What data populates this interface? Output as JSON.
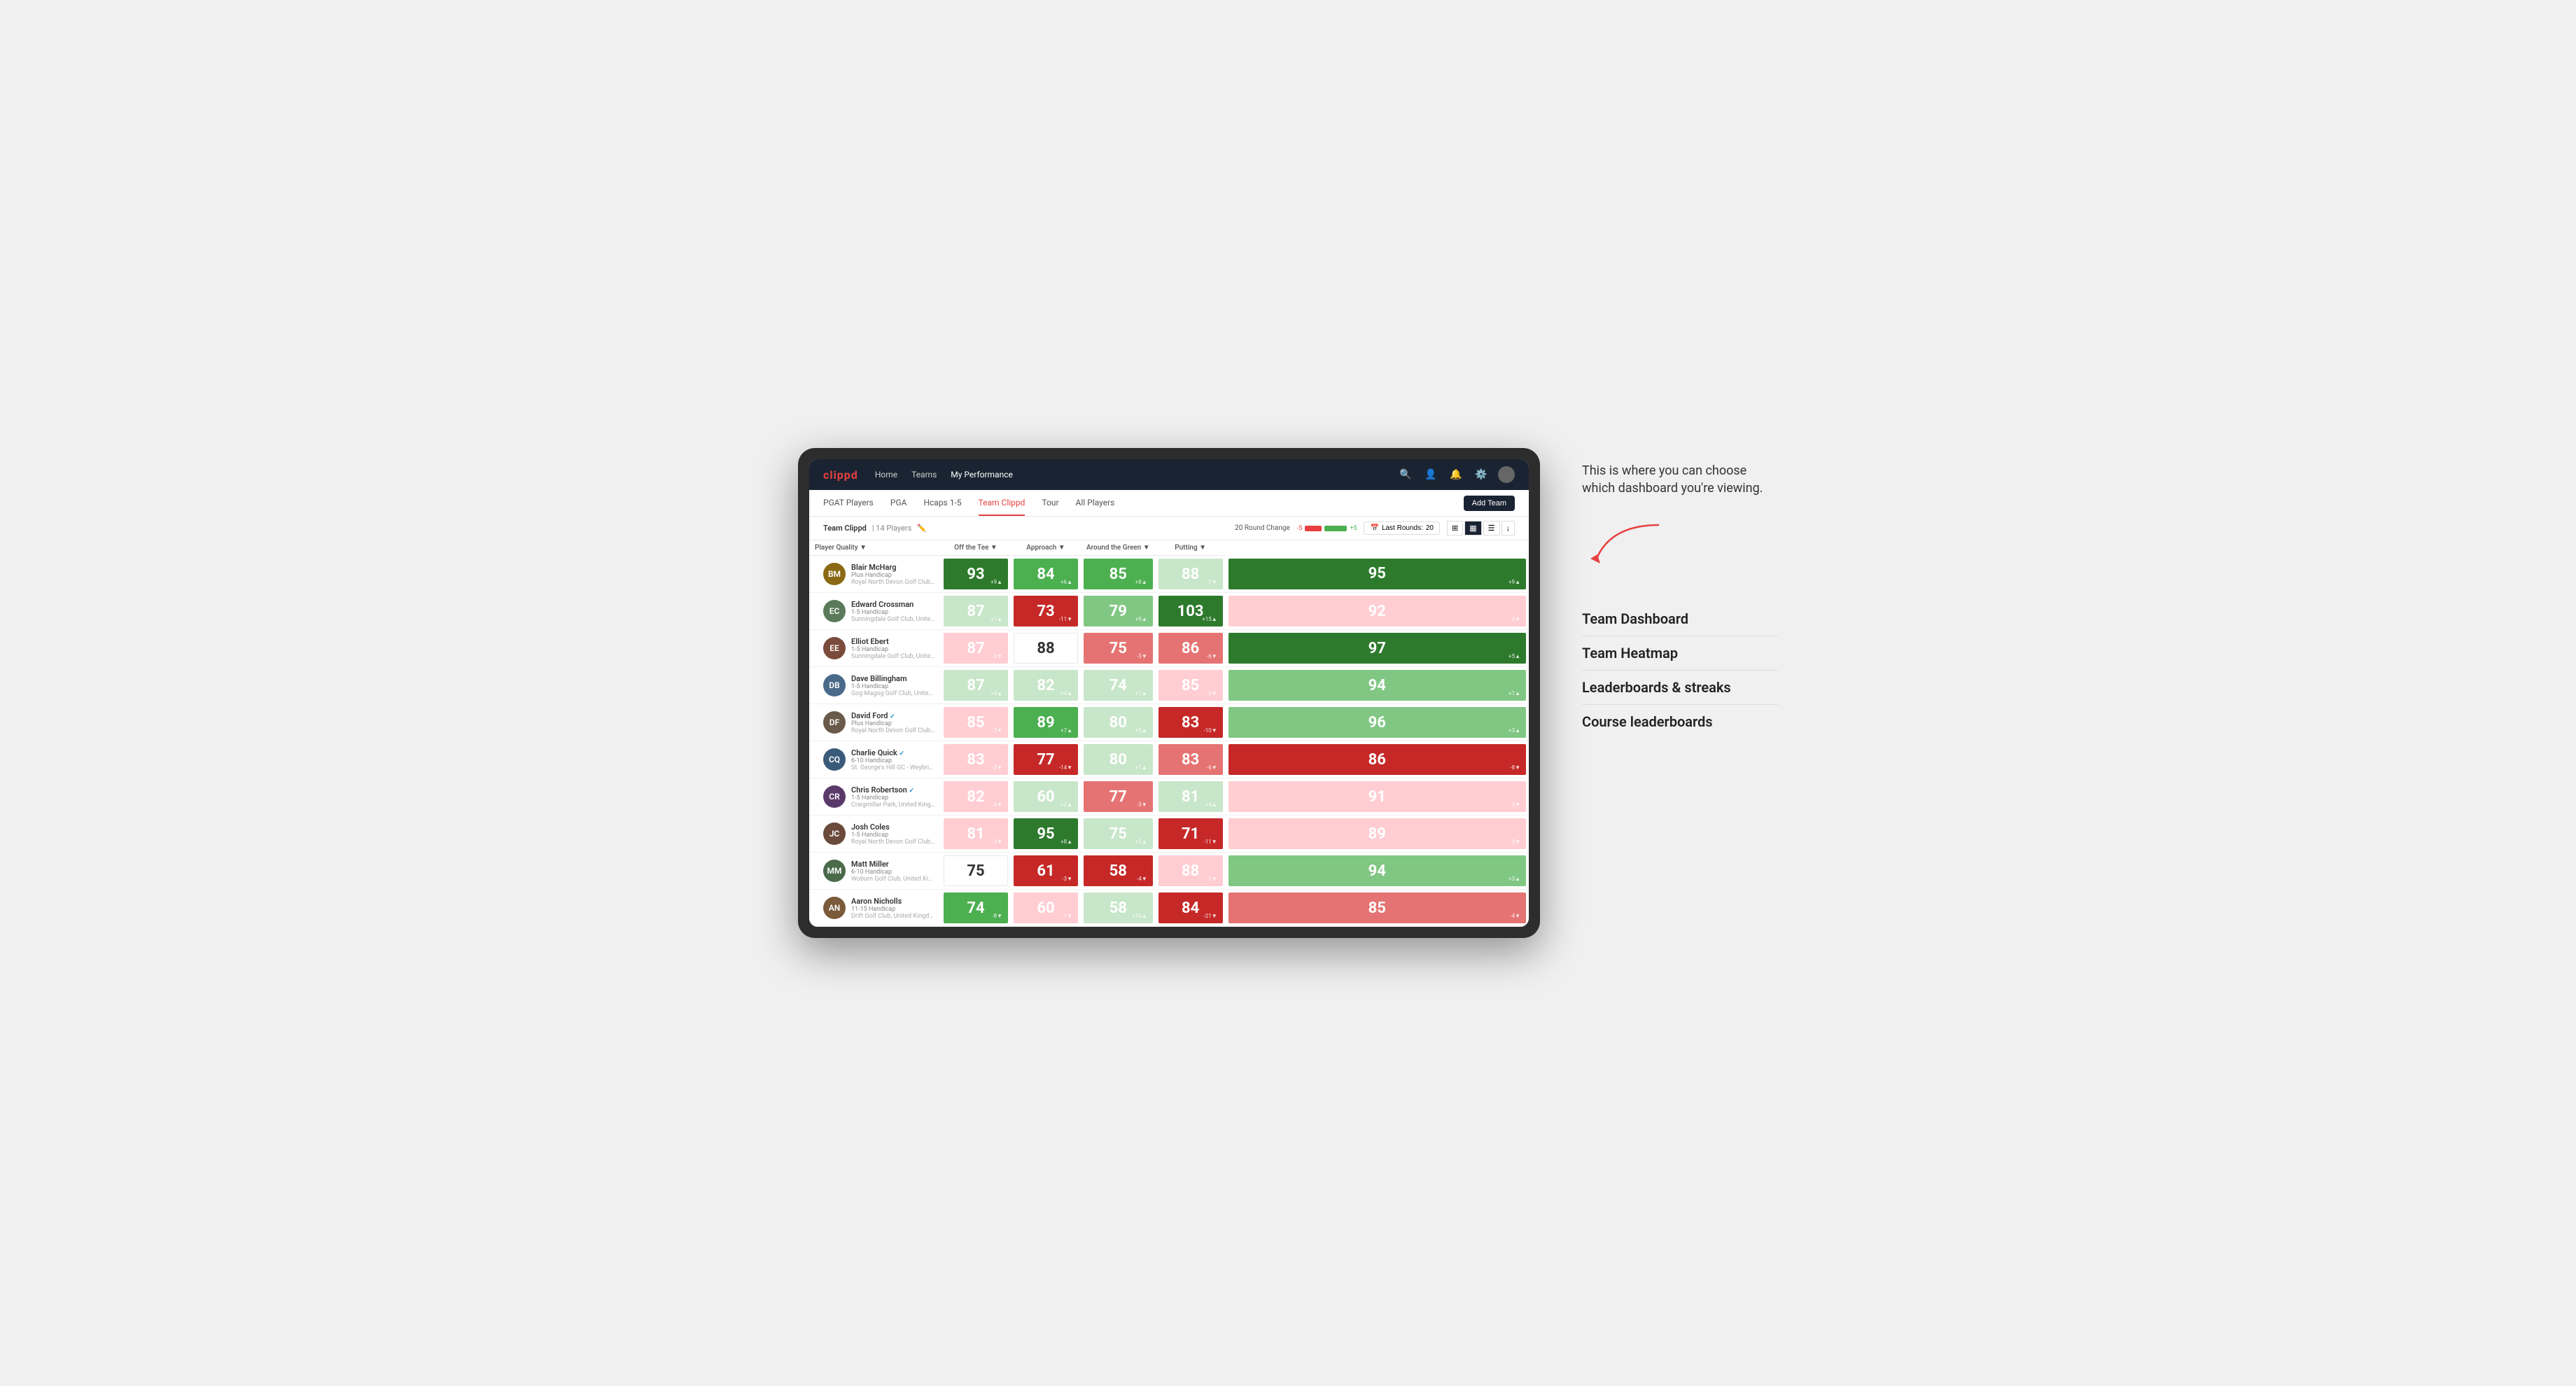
{
  "annotation": {
    "description": "This is where you can choose which dashboard you're viewing.",
    "menu_items": [
      "Team Dashboard",
      "Team Heatmap",
      "Leaderboards & streaks",
      "Course leaderboards"
    ]
  },
  "nav": {
    "logo": "clippd",
    "links": [
      "Home",
      "Teams",
      "My Performance"
    ],
    "active_link": "My Performance"
  },
  "sub_nav": {
    "links": [
      "PGAT Players",
      "PGA",
      "Hcaps 1-5",
      "Team Clippd",
      "Tour",
      "All Players"
    ],
    "active_link": "Team Clippd",
    "add_team_label": "Add Team"
  },
  "team_header": {
    "name": "Team Clippd",
    "separator": "|",
    "count": "14 Players",
    "round_change_label": "20 Round Change",
    "change_neg": "-5",
    "change_pos": "+5",
    "last_rounds_label": "Last Rounds:",
    "last_rounds_value": "20"
  },
  "table": {
    "columns": [
      "Player Quality ▼",
      "Off the Tee ▼",
      "Approach ▼",
      "Around the Green ▼",
      "Putting ▼"
    ],
    "rows": [
      {
        "name": "Blair McHarg",
        "handicap": "Plus Handicap",
        "club": "Royal North Devon Golf Club, United Kingdom",
        "avatar_initials": "BM",
        "avatar_color": "#8B6914",
        "scores": [
          {
            "value": 93,
            "change": "+9",
            "dir": "up",
            "bg": "bg-dark-green"
          },
          {
            "value": 84,
            "change": "+6",
            "dir": "up",
            "bg": "bg-med-green"
          },
          {
            "value": 85,
            "change": "+8",
            "dir": "up",
            "bg": "bg-med-green"
          },
          {
            "value": 88,
            "change": "-1",
            "dir": "down",
            "bg": "bg-pale-green"
          },
          {
            "value": 95,
            "change": "+9",
            "dir": "up",
            "bg": "bg-dark-green"
          }
        ]
      },
      {
        "name": "Edward Crossman",
        "handicap": "1-5 Handicap",
        "club": "Sunningdale Golf Club, United Kingdom",
        "avatar_initials": "EC",
        "avatar_color": "#5a7a5a",
        "scores": [
          {
            "value": 87,
            "change": "+1",
            "dir": "up",
            "bg": "bg-pale-green"
          },
          {
            "value": 73,
            "change": "-11",
            "dir": "down",
            "bg": "bg-dark-red"
          },
          {
            "value": 79,
            "change": "+9",
            "dir": "up",
            "bg": "bg-light-green"
          },
          {
            "value": 103,
            "change": "+15",
            "dir": "up",
            "bg": "bg-dark-green"
          },
          {
            "value": 92,
            "change": "-3",
            "dir": "down",
            "bg": "bg-pale-red"
          }
        ]
      },
      {
        "name": "Elliot Ebert",
        "handicap": "1-5 Handicap",
        "club": "Sunningdale Golf Club, United Kingdom",
        "avatar_initials": "EE",
        "avatar_color": "#7a4a3a",
        "scores": [
          {
            "value": 87,
            "change": "-3",
            "dir": "down",
            "bg": "bg-pale-red"
          },
          {
            "value": 88,
            "change": "",
            "dir": "",
            "bg": "bg-white"
          },
          {
            "value": 75,
            "change": "-3",
            "dir": "down",
            "bg": "bg-med-red"
          },
          {
            "value": 86,
            "change": "-6",
            "dir": "down",
            "bg": "bg-med-red"
          },
          {
            "value": 97,
            "change": "+5",
            "dir": "up",
            "bg": "bg-dark-green"
          }
        ]
      },
      {
        "name": "Dave Billingham",
        "handicap": "1-5 Handicap",
        "club": "Gog Magog Golf Club, United Kingdom",
        "avatar_initials": "DB",
        "avatar_color": "#4a6a8a",
        "scores": [
          {
            "value": 87,
            "change": "+4",
            "dir": "up",
            "bg": "bg-pale-green"
          },
          {
            "value": 82,
            "change": "+4",
            "dir": "up",
            "bg": "bg-pale-green"
          },
          {
            "value": 74,
            "change": "+1",
            "dir": "up",
            "bg": "bg-pale-green"
          },
          {
            "value": 85,
            "change": "-3",
            "dir": "down",
            "bg": "bg-pale-red"
          },
          {
            "value": 94,
            "change": "+1",
            "dir": "up",
            "bg": "bg-light-green"
          }
        ]
      },
      {
        "name": "David Ford",
        "handicap": "Plus Handicap",
        "club": "Royal North Devon Golf Club, United Kingdom",
        "avatar_initials": "DF",
        "avatar_color": "#6a5a4a",
        "verified": true,
        "scores": [
          {
            "value": 85,
            "change": "-3",
            "dir": "down",
            "bg": "bg-pale-red"
          },
          {
            "value": 89,
            "change": "+7",
            "dir": "up",
            "bg": "bg-med-green"
          },
          {
            "value": 80,
            "change": "+3",
            "dir": "up",
            "bg": "bg-pale-green"
          },
          {
            "value": 83,
            "change": "-10",
            "dir": "down",
            "bg": "bg-dark-red"
          },
          {
            "value": 96,
            "change": "+3",
            "dir": "up",
            "bg": "bg-light-green"
          }
        ]
      },
      {
        "name": "Charlie Quick",
        "handicap": "6-10 Handicap",
        "club": "St. George's Hill GC - Weybridge - Surrey, Uni...",
        "avatar_initials": "CQ",
        "avatar_color": "#3a5a7a",
        "verified": true,
        "scores": [
          {
            "value": 83,
            "change": "-3",
            "dir": "down",
            "bg": "bg-pale-red"
          },
          {
            "value": 77,
            "change": "-14",
            "dir": "down",
            "bg": "bg-dark-red"
          },
          {
            "value": 80,
            "change": "+1",
            "dir": "up",
            "bg": "bg-pale-green"
          },
          {
            "value": 83,
            "change": "-6",
            "dir": "down",
            "bg": "bg-med-red"
          },
          {
            "value": 86,
            "change": "-8",
            "dir": "down",
            "bg": "bg-dark-red"
          }
        ]
      },
      {
        "name": "Chris Robertson",
        "handicap": "1-5 Handicap",
        "club": "Craigmillar Park, United Kingdom",
        "avatar_initials": "CR",
        "avatar_color": "#5a3a6a",
        "verified": true,
        "scores": [
          {
            "value": 82,
            "change": "-3",
            "dir": "down",
            "bg": "bg-pale-red"
          },
          {
            "value": 60,
            "change": "+2",
            "dir": "up",
            "bg": "bg-pale-green"
          },
          {
            "value": 77,
            "change": "-3",
            "dir": "down",
            "bg": "bg-med-red"
          },
          {
            "value": 81,
            "change": "+4",
            "dir": "up",
            "bg": "bg-pale-green"
          },
          {
            "value": 91,
            "change": "-3",
            "dir": "down",
            "bg": "bg-pale-red"
          }
        ]
      },
      {
        "name": "Josh Coles",
        "handicap": "1-5 Handicap",
        "club": "Royal North Devon Golf Club, United Kingdom",
        "avatar_initials": "JC",
        "avatar_color": "#6a4a3a",
        "scores": [
          {
            "value": 81,
            "change": "-3",
            "dir": "down",
            "bg": "bg-pale-red"
          },
          {
            "value": 95,
            "change": "+8",
            "dir": "up",
            "bg": "bg-dark-green"
          },
          {
            "value": 75,
            "change": "+2",
            "dir": "up",
            "bg": "bg-pale-green"
          },
          {
            "value": 71,
            "change": "-11",
            "dir": "down",
            "bg": "bg-dark-red"
          },
          {
            "value": 89,
            "change": "-2",
            "dir": "down",
            "bg": "bg-pale-red"
          }
        ]
      },
      {
        "name": "Matt Miller",
        "handicap": "6-10 Handicap",
        "club": "Woburn Golf Club, United Kingdom",
        "avatar_initials": "MM",
        "avatar_color": "#4a6a4a",
        "scores": [
          {
            "value": 75,
            "change": "",
            "dir": "",
            "bg": "bg-white"
          },
          {
            "value": 61,
            "change": "-3",
            "dir": "down",
            "bg": "bg-dark-red"
          },
          {
            "value": 58,
            "change": "-4",
            "dir": "down",
            "bg": "bg-dark-red"
          },
          {
            "value": 88,
            "change": "-2",
            "dir": "down",
            "bg": "bg-pale-red"
          },
          {
            "value": 94,
            "change": "+3",
            "dir": "up",
            "bg": "bg-light-green"
          }
        ]
      },
      {
        "name": "Aaron Nicholls",
        "handicap": "11-15 Handicap",
        "club": "Drift Golf Club, United Kingdom",
        "avatar_initials": "AN",
        "avatar_color": "#7a5a3a",
        "scores": [
          {
            "value": 74,
            "change": "-8",
            "dir": "down",
            "bg": "bg-med-green"
          },
          {
            "value": 60,
            "change": "-1",
            "dir": "down",
            "bg": "bg-pale-red"
          },
          {
            "value": 58,
            "change": "+10",
            "dir": "up",
            "bg": "bg-pale-green"
          },
          {
            "value": 84,
            "change": "-21",
            "dir": "down",
            "bg": "bg-dark-red"
          },
          {
            "value": 85,
            "change": "-4",
            "dir": "down",
            "bg": "bg-med-red"
          }
        ]
      }
    ]
  }
}
